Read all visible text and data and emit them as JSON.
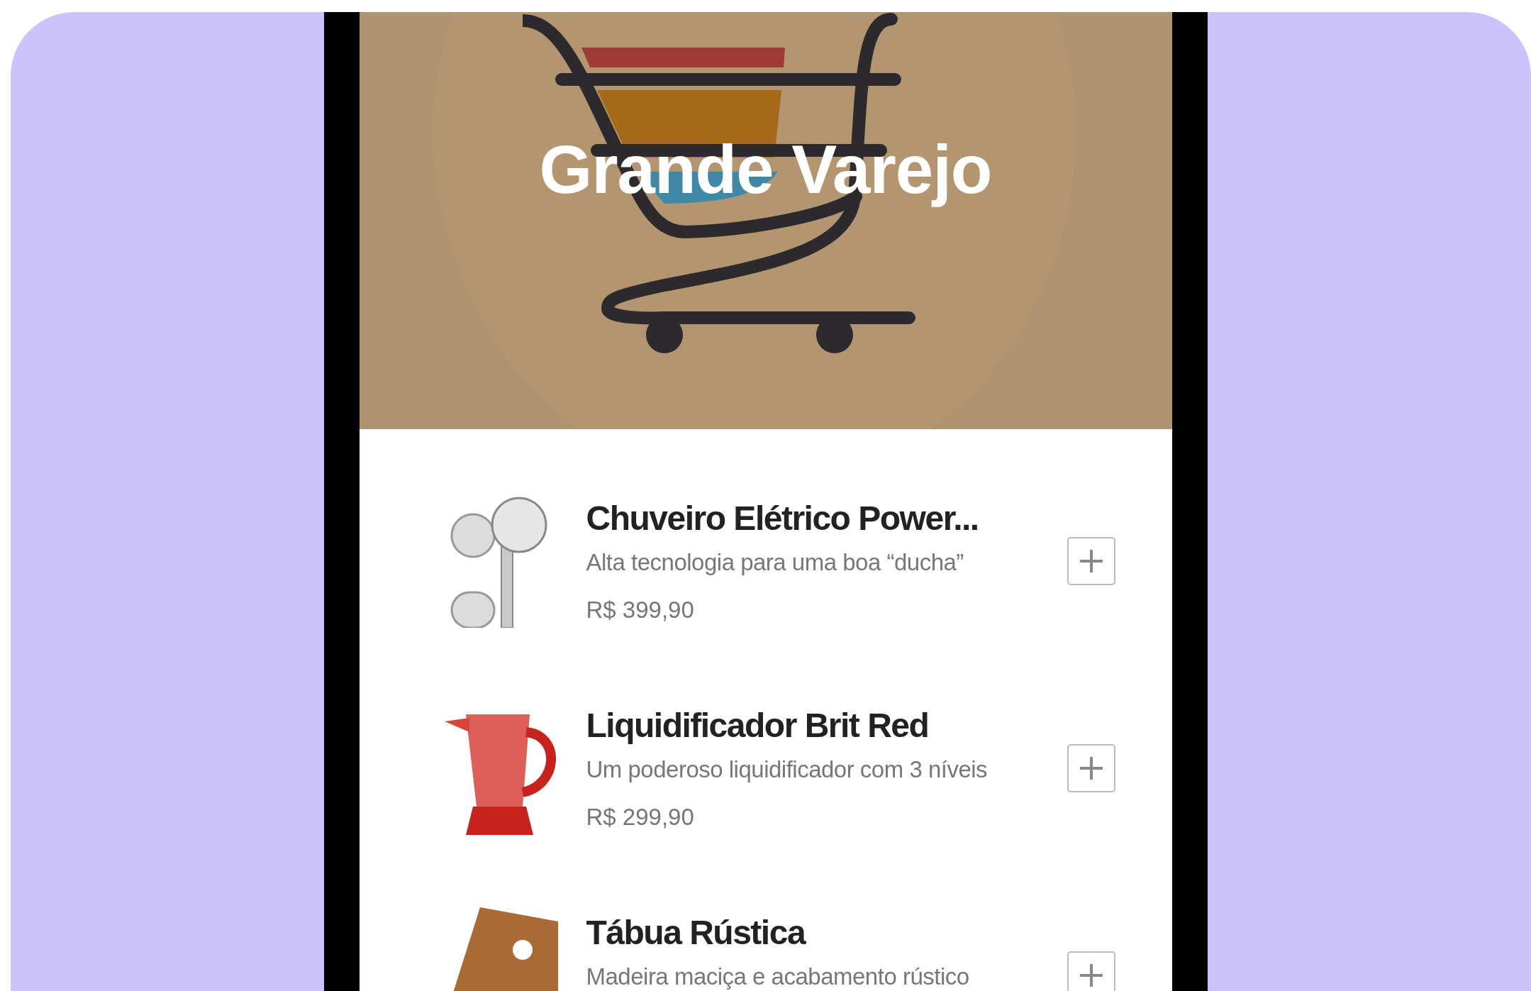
{
  "header": {
    "title": "Grande Varejo"
  },
  "products": [
    {
      "name": "Chuveiro Elétrico Power...",
      "description": "Alta tecnologia para uma boa “ducha”",
      "price": "R$ 399,90",
      "kind": "shower"
    },
    {
      "name": "Liquidificador Brit Red",
      "description": "Um poderoso liquidificador com 3 níveis",
      "price": "R$ 299,90",
      "kind": "blender"
    },
    {
      "name": "Tábua Rústica",
      "description": "Madeira maciça e acabamento rústico",
      "kind": "board"
    }
  ]
}
